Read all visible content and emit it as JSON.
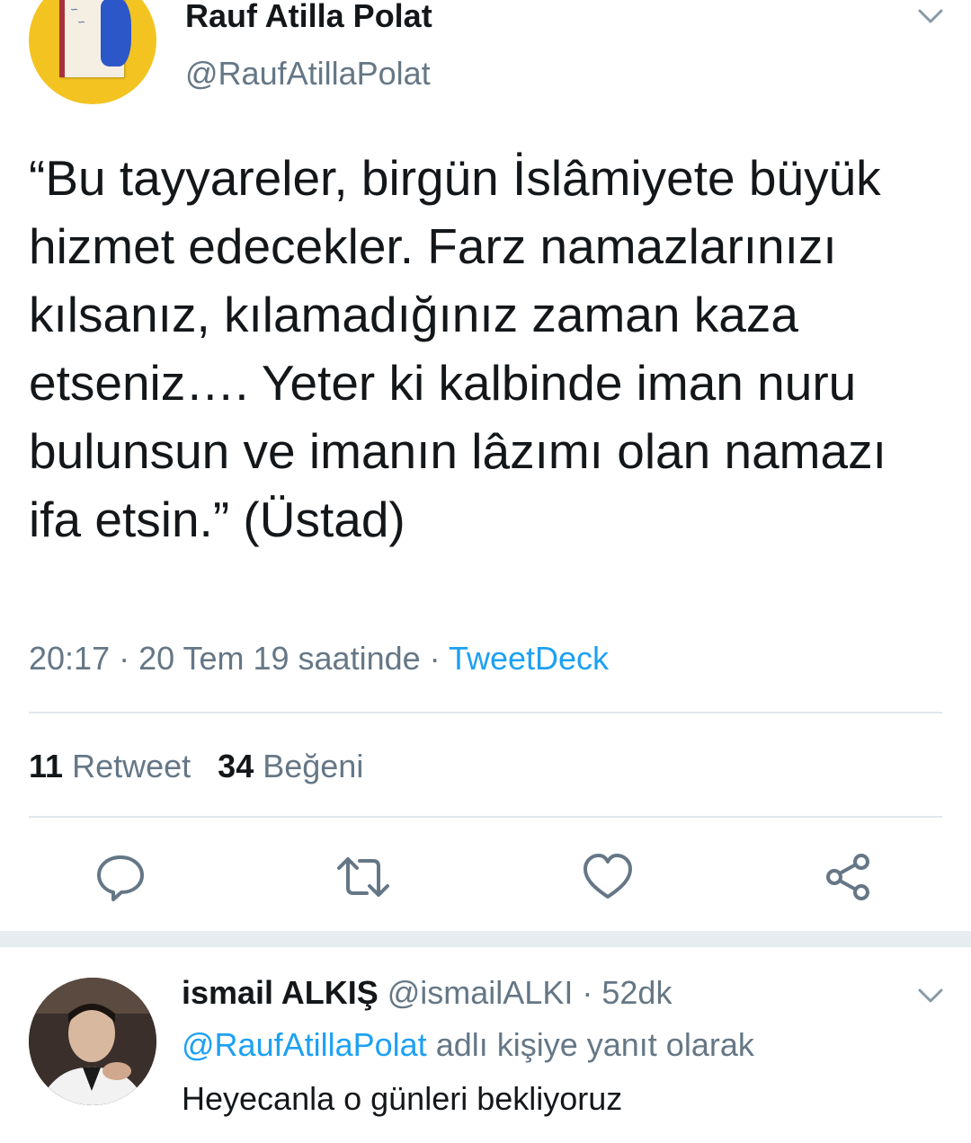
{
  "tweet": {
    "author_name": "Rauf Atilla Polat",
    "author_handle": "@RaufAtillaPolat",
    "avatar_icon": "book-cover-avatar",
    "text": "“Bu tayyareler, birgün İslâmiyete büyük hizmet edecekler. Farz namazlarınızı kılsanız, kılamadığınız zaman kaza etseniz…. Yeter ki kalbinde iman nuru bulunsun ve imanın lâzımı olan namazı ifa etsin.” (Üstad)",
    "timestamp": "20:17 · 20 Tem 19 saatinde · ",
    "source": "TweetDeck",
    "retweet_count": "11",
    "retweet_label": "Retweet",
    "like_count": "34",
    "like_label": "Beğeni"
  },
  "actions": [
    {
      "icon": "reply-icon"
    },
    {
      "icon": "retweet-icon"
    },
    {
      "icon": "like-icon"
    },
    {
      "icon": "share-icon"
    }
  ],
  "reply": {
    "author_name": "ismail ALKIŞ",
    "author_handle": "@ismailALKI",
    "time": "52dk",
    "replying_to": "@RaufAtillaPolat",
    "replying_suffix": "adlı kişiye yanıt olarak",
    "text": "Heyecanla o günleri bekliyoruz"
  },
  "colors": {
    "text": "#14171a",
    "secondary": "#657786",
    "link": "#1da1f2",
    "divider": "#e1e8ed",
    "separator": "#e6ecf0"
  }
}
